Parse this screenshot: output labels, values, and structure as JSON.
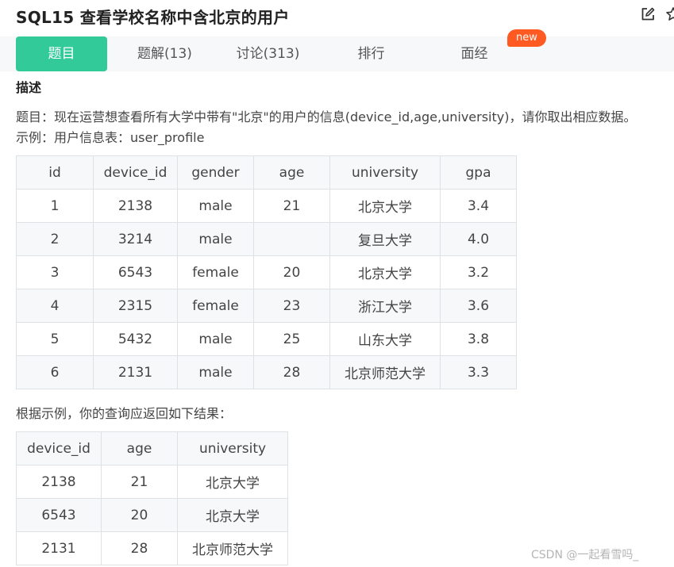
{
  "page": {
    "title": "SQL15  查看学校名称中含北京的用户"
  },
  "header_icons": [
    "edit-icon",
    "star-icon"
  ],
  "tabs": [
    {
      "label": "题目",
      "active": true
    },
    {
      "label": "题解(13)",
      "active": false
    },
    {
      "label": "讨论(313)",
      "active": false
    },
    {
      "label": "排行",
      "active": false
    },
    {
      "label": "面经",
      "active": false
    }
  ],
  "badge": "new",
  "description": {
    "heading": "描述",
    "problem": "题目：现在运营想查看所有大学中带有\"北京\"的用户的信息(device_id,age,university)，请你取出相应数据。",
    "example": "示例：用户信息表：user_profile",
    "result_intro": "根据示例，你的查询应返回如下结果："
  },
  "user_profile": {
    "headers": [
      "id",
      "device_id",
      "gender",
      "age",
      "university",
      "gpa"
    ],
    "rows": [
      [
        "1",
        "2138",
        "male",
        "21",
        "北京大学",
        "3.4"
      ],
      [
        "2",
        "3214",
        "male",
        "",
        "复旦大学",
        "4.0"
      ],
      [
        "3",
        "6543",
        "female",
        "20",
        "北京大学",
        "3.2"
      ],
      [
        "4",
        "2315",
        "female",
        "23",
        "浙江大学",
        "3.6"
      ],
      [
        "5",
        "5432",
        "male",
        "25",
        "山东大学",
        "3.8"
      ],
      [
        "6",
        "2131",
        "male",
        "28",
        "北京师范大学",
        "3.3"
      ]
    ]
  },
  "result_table": {
    "headers": [
      "device_id",
      "age",
      "university"
    ],
    "rows": [
      [
        "2138",
        "21",
        "北京大学"
      ],
      [
        "6543",
        "20",
        "北京大学"
      ],
      [
        "2131",
        "28",
        "北京师范大学"
      ]
    ]
  },
  "watermark": "CSDN @一起看雪吗_",
  "colors": {
    "accent": "#32ca99",
    "badge": "#fe5a22",
    "tab_bar_bg": "#f7f8fa",
    "table_header_bg": "#f6f8fa",
    "border": "#dfe2e5"
  }
}
